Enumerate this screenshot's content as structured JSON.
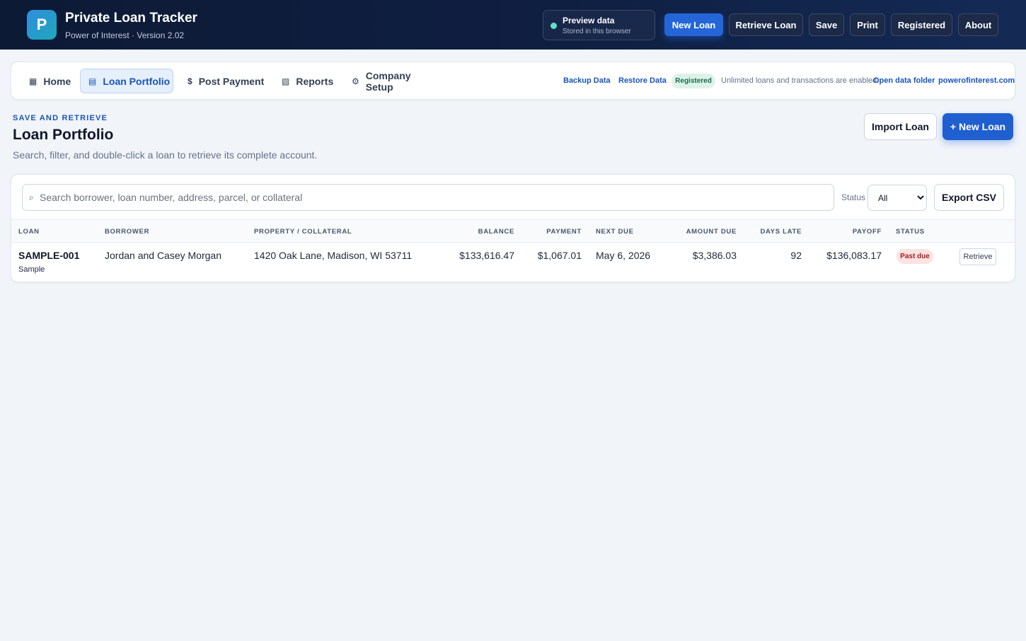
{
  "app": {
    "logo_letter": "P",
    "title": "Private Loan Tracker",
    "subtitle": "Power of Interest · Version 2.02"
  },
  "preview": {
    "title": "Preview data",
    "subtitle": "Stored in this browser"
  },
  "header_buttons": {
    "new_loan": "New Loan",
    "retrieve_loan": "Retrieve Loan",
    "save": "Save",
    "print": "Print",
    "registered": "Registered",
    "about": "About"
  },
  "nav": {
    "tabs": [
      {
        "label": "Home",
        "icon": "▦"
      },
      {
        "label": "Loan Portfolio",
        "icon": "▤"
      },
      {
        "label": "Post Payment",
        "icon": "$"
      },
      {
        "label": "Reports",
        "icon": "▧"
      },
      {
        "label": "Company Setup",
        "icon": "⚙"
      }
    ],
    "backup": "Backup Data",
    "restore": "Restore Data",
    "badge": "Registered",
    "note": "Unlimited loans and transactions are enabled.",
    "open_folder": "Open data folder",
    "website": "powerofinterest.com"
  },
  "section": {
    "eyebrow": "SAVE AND RETRIEVE",
    "title": "Loan Portfolio",
    "description": "Search, filter, and double-click a loan to retrieve its complete account.",
    "import_label": "Import Loan",
    "new_label": "+ New Loan"
  },
  "filters": {
    "search_placeholder": "Search borrower, loan number, address, parcel, or collateral",
    "search_value": "",
    "status_label": "Status",
    "status_selected": "All",
    "export_label": "Export CSV"
  },
  "table": {
    "columns": [
      "LOAN",
      "BORROWER",
      "PROPERTY / COLLATERAL",
      "BALANCE",
      "PAYMENT",
      "NEXT DUE",
      "AMOUNT DUE",
      "DAYS LATE",
      "PAYOFF",
      "STATUS"
    ],
    "rows": [
      {
        "loan": "SAMPLE-001",
        "loan_sub": "Sample",
        "borrower": "Jordan and Casey Morgan",
        "property": "1420 Oak Lane, Madison, WI 53711",
        "balance": "$133,616.47",
        "payment": "$1,067.01",
        "next_due": "May 6, 2026",
        "amount_due": "$3,386.03",
        "days_late": "92",
        "payoff": "$136,083.17",
        "status": "Past due",
        "action": "Retrieve"
      }
    ]
  }
}
